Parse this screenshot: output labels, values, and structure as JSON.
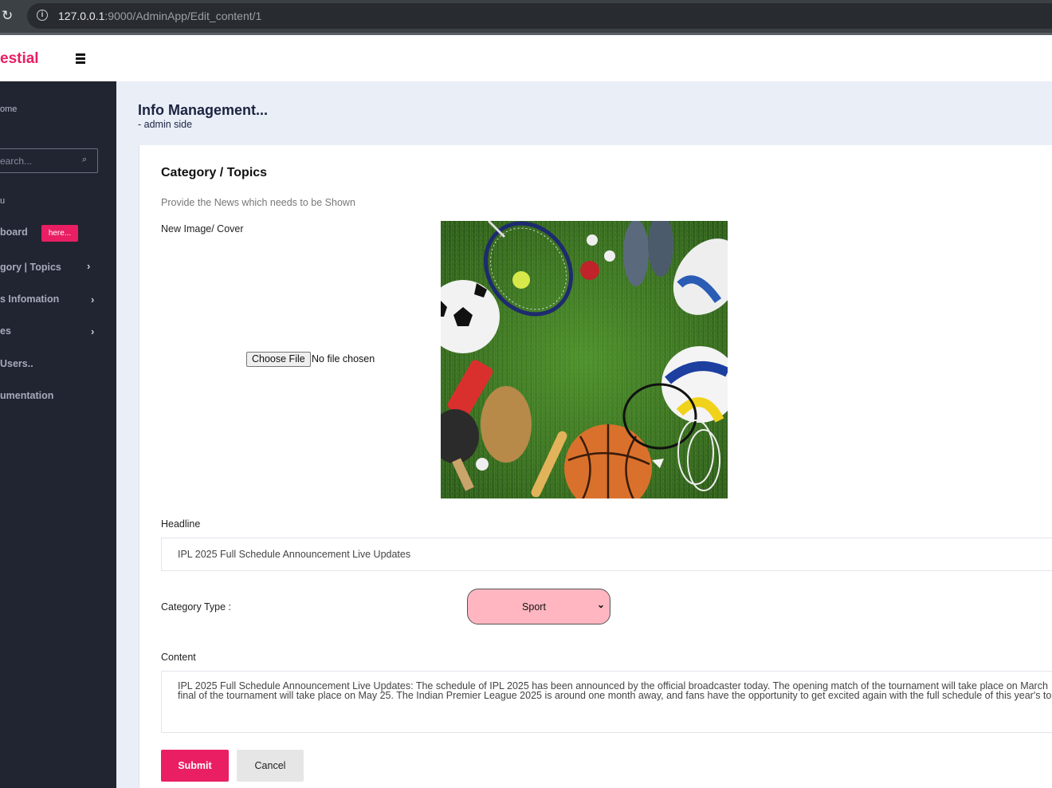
{
  "browser": {
    "url_host": "127.0.0.1",
    "url_rest": ":9000/AdminApp/Edit_content/1"
  },
  "header": {
    "brand": "estial"
  },
  "sidebar": {
    "section_home": "ome",
    "search_placeholder": "earch...",
    "section_menu": "u",
    "items": [
      {
        "label": "board",
        "badge": "here..."
      },
      {
        "label": "gory | Topics"
      },
      {
        "label": "s Infomation"
      },
      {
        "label": "es"
      },
      {
        "label": "Users.."
      },
      {
        "label": "umentation"
      }
    ]
  },
  "main": {
    "title": "Info Management...",
    "subtitle": "- admin side"
  },
  "form": {
    "title": "Category / Topics",
    "description": "Provide the News which needs to be Shown",
    "image_label": "New Image/ Cover",
    "file_button": "Choose File",
    "file_status": "No file chosen",
    "headline_label": "Headline",
    "headline_value": "IPL 2025 Full Schedule Announcement Live Updates",
    "category_label": "Category Type :",
    "category_value": "Sport",
    "content_label": "Content",
    "content_value": "IPL 2025 Full Schedule Announcement Live Updates: The schedule of IPL 2025 has been announced by the official broadcaster today. The opening match of the tournament will take place on March\nfinal of the tournament will take place on May 25. The Indian Premier League 2025 is around one month away, and fans have the opportunity to get excited again with the full schedule of this year's to",
    "submit_label": "Submit",
    "cancel_label": "Cancel"
  },
  "colors": {
    "accent": "#e91e63",
    "sidebar_bg": "#212431",
    "main_bg": "#e9eef7",
    "select_bg": "#ffb6c1"
  }
}
